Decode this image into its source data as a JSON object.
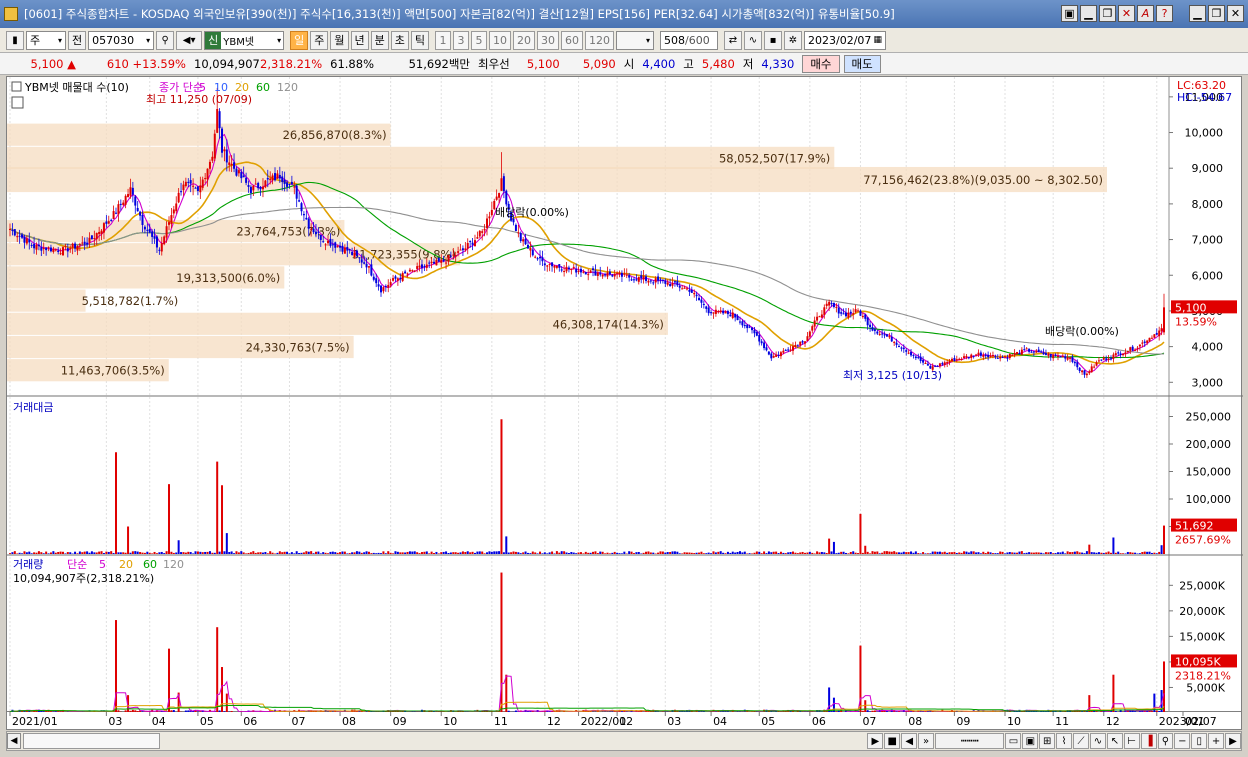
{
  "window": {
    "title": "[0601] 주식종합차트 - KOSDAQ 외국인보유[390(천)] 주식수[16,313(천)] 액면[500] 자본금[82(억)] 결산[12월] EPS[156] PER[32.64] 시가총액[832(억)] 유통비율[50.9]",
    "buttons": [
      "▣",
      "▁",
      "❐",
      "✕",
      "A",
      "?",
      "▁",
      "❐",
      "✕"
    ]
  },
  "toolbar": {
    "mode": "주",
    "prev": "전",
    "code": "057030",
    "stock_name": "YBM넷",
    "new_badge": "신",
    "periods": [
      "일",
      "주",
      "월",
      "년",
      "분",
      "초",
      "틱"
    ],
    "active_period": "일",
    "intervals": [
      "1",
      "3",
      "5",
      "10",
      "20",
      "30",
      "60",
      "120"
    ],
    "count": "508",
    "count_max": "/600",
    "date": "2023/02/07"
  },
  "quote": {
    "price": "5,100",
    "change_arrow": "▲",
    "change": "610",
    "change_pct": "+13.59%",
    "volume": "10,094,907",
    "volume_ratio": "2,318.21%",
    "strength": "61.88%",
    "amount": "51,692백만",
    "best_label": "최우선",
    "ask": "5,100",
    "bid": "5,090",
    "open_label": "시",
    "open": "4,400",
    "high_label": "고",
    "high": "5,480",
    "low_label": "저",
    "low": "4,330",
    "buy_label": "매수",
    "sell_label": "매도"
  },
  "chart_data": [
    {
      "type": "candlestick",
      "title": "YBM넷 매물대 수(10)",
      "ma_legend": [
        "종가 단순",
        "5",
        "10",
        "20",
        "60",
        "120"
      ],
      "ma_colors": {
        "5": "#d000d0",
        "10": "#3060ff",
        "20": "#e0a000",
        "60": "#00a000",
        "120": "#909090"
      },
      "top_right": {
        "lc": "LC:63.20",
        "hc": "HC:-54.67"
      },
      "y_ticks": [
        "11,000",
        "10,000",
        "9,000",
        "8,000",
        "7,000",
        "6,000",
        "5,000",
        "4,000",
        "3,000"
      ],
      "ylim": [
        2700,
        11500
      ],
      "last_price_label": "5,100",
      "last_change_label": "13.59%",
      "annotations": {
        "high": "최고 11,250 (07/09)",
        "low": "최저 3,125 (10/13)",
        "dividend1": "배당락(0.00%)",
        "dividend2": "배당락(0.00%)"
      },
      "volume_profile": [
        {
          "label": "11,463,706(3.5%)",
          "low": 3000,
          "high": 3650,
          "pct": 3.5
        },
        {
          "label": "24,330,763(7.5%)",
          "low": 3650,
          "high": 4300,
          "pct": 7.5
        },
        {
          "label": "46,308,174(14.3%)",
          "low": 4300,
          "high": 4950,
          "pct": 14.3
        },
        {
          "label": "5,518,782(1.7%)",
          "low": 4950,
          "high": 5600,
          "pct": 1.7
        },
        {
          "label": "19,313,500(6.0%)",
          "low": 5600,
          "high": 6250,
          "pct": 6.0
        },
        {
          "label": "31,723,355(9.8%)",
          "low": 6250,
          "high": 6900,
          "pct": 9.8
        },
        {
          "label": "23,764,753(7.3%)",
          "low": 6900,
          "high": 7550,
          "pct": 7.3
        },
        {
          "label": "77,156,462(23.8%)(9,035.00 ~ 8,302.50)",
          "low": 8302.5,
          "high": 9035,
          "pct": 23.8
        },
        {
          "label": "58,052,507(17.9%)",
          "low": 8950,
          "high": 9600,
          "pct": 17.9
        },
        {
          "label": "26,856,870(8.3%)",
          "low": 9600,
          "high": 10250,
          "pct": 8.3
        }
      ],
      "close_keypoints": [
        [
          0,
          7300
        ],
        [
          10,
          6800
        ],
        [
          22,
          6700
        ],
        [
          33,
          6950
        ],
        [
          43,
          7700
        ],
        [
          50,
          8400
        ],
        [
          55,
          7500
        ],
        [
          62,
          6700
        ],
        [
          68,
          7900
        ],
        [
          72,
          8600
        ],
        [
          78,
          8300
        ],
        [
          84,
          9400
        ],
        [
          86,
          10600
        ],
        [
          88,
          9500
        ],
        [
          94,
          8900
        ],
        [
          100,
          8400
        ],
        [
          112,
          8800
        ],
        [
          118,
          8400
        ],
        [
          124,
          7400
        ],
        [
          130,
          7000
        ],
        [
          140,
          6700
        ],
        [
          148,
          6300
        ],
        [
          154,
          5600
        ],
        [
          160,
          5900
        ],
        [
          170,
          6200
        ],
        [
          180,
          6400
        ],
        [
          188,
          6700
        ],
        [
          196,
          7200
        ],
        [
          204,
          8600
        ],
        [
          208,
          7600
        ],
        [
          212,
          7000
        ],
        [
          220,
          6400
        ],
        [
          230,
          6200
        ],
        [
          240,
          6100
        ],
        [
          252,
          6000
        ],
        [
          262,
          5900
        ],
        [
          272,
          5800
        ],
        [
          282,
          5600
        ],
        [
          290,
          5000
        ],
        [
          300,
          4900
        ],
        [
          310,
          4300
        ],
        [
          316,
          3700
        ],
        [
          322,
          3900
        ],
        [
          330,
          4200
        ],
        [
          336,
          4900
        ],
        [
          340,
          5200
        ],
        [
          346,
          4900
        ],
        [
          352,
          5000
        ],
        [
          358,
          4500
        ],
        [
          366,
          4200
        ],
        [
          376,
          3700
        ],
        [
          382,
          3400
        ],
        [
          390,
          3600
        ],
        [
          402,
          3800
        ],
        [
          412,
          3700
        ],
        [
          422,
          3900
        ],
        [
          432,
          3750
        ],
        [
          440,
          3700
        ],
        [
          446,
          3200
        ],
        [
          452,
          3600
        ],
        [
          460,
          3800
        ],
        [
          468,
          4000
        ],
        [
          474,
          4300
        ],
        [
          478,
          4490
        ],
        [
          479,
          5100
        ]
      ]
    },
    {
      "type": "bar",
      "title": "거래대금",
      "y_ticks": [
        "250,000",
        "200,000",
        "150,000",
        "100,000",
        "50,000"
      ],
      "ylim": [
        0,
        260000
      ],
      "last_value_label": "51,692",
      "last_ratio_label": "2657.69%",
      "spikes": [
        {
          "i": 44,
          "v": 185000
        },
        {
          "i": 49,
          "v": 50000
        },
        {
          "i": 66,
          "v": 127000
        },
        {
          "i": 70,
          "v": 25000
        },
        {
          "i": 86,
          "v": 168000
        },
        {
          "i": 88,
          "v": 125000
        },
        {
          "i": 90,
          "v": 38000
        },
        {
          "i": 204,
          "v": 245000
        },
        {
          "i": 206,
          "v": 32000
        },
        {
          "i": 340,
          "v": 28000
        },
        {
          "i": 342,
          "v": 22000
        },
        {
          "i": 353,
          "v": 73000
        },
        {
          "i": 355,
          "v": 15000
        },
        {
          "i": 448,
          "v": 17000
        },
        {
          "i": 458,
          "v": 30000
        },
        {
          "i": 478,
          "v": 16000
        },
        {
          "i": 479,
          "v": 51692
        }
      ]
    },
    {
      "type": "bar",
      "title": "거래량",
      "legend": [
        "단순",
        "5",
        "20",
        "60",
        "120"
      ],
      "subtitle": "10,094,907주(2,318.21%)",
      "y_ticks": [
        "25,000K",
        "20,000K",
        "15,000K",
        "10,000K",
        "5,000K"
      ],
      "ylim": [
        0,
        28000
      ],
      "last_value_label": "10,095K",
      "last_ratio_label": "2318.21%",
      "spikes": [
        {
          "i": 44,
          "v": 18200
        },
        {
          "i": 49,
          "v": 3500
        },
        {
          "i": 66,
          "v": 12600
        },
        {
          "i": 70,
          "v": 4000
        },
        {
          "i": 86,
          "v": 16800
        },
        {
          "i": 88,
          "v": 9000
        },
        {
          "i": 90,
          "v": 3800
        },
        {
          "i": 204,
          "v": 27500
        },
        {
          "i": 206,
          "v": 7500
        },
        {
          "i": 340,
          "v": 5000
        },
        {
          "i": 342,
          "v": 3000
        },
        {
          "i": 353,
          "v": 13200
        },
        {
          "i": 355,
          "v": 2500
        },
        {
          "i": 448,
          "v": 3500
        },
        {
          "i": 458,
          "v": 7500
        },
        {
          "i": 475,
          "v": 3800
        },
        {
          "i": 478,
          "v": 4500
        },
        {
          "i": 479,
          "v": 10095
        }
      ]
    }
  ],
  "time_axis": {
    "labels": [
      "2021/01",
      "03",
      "04",
      "05",
      "06",
      "07",
      "08",
      "09",
      "10",
      "11",
      "12",
      "2022/01",
      "02",
      "03",
      "04",
      "05",
      "06",
      "07",
      "08",
      "09",
      "10",
      "11",
      "12",
      "2023/01",
      "02",
      "02/07"
    ],
    "label_index": [
      0,
      40,
      58,
      78,
      96,
      116,
      137,
      158,
      179,
      200,
      222,
      236,
      252,
      272,
      291,
      311,
      332,
      353,
      372,
      392,
      413,
      433,
      454,
      476,
      492,
      524
    ]
  }
}
